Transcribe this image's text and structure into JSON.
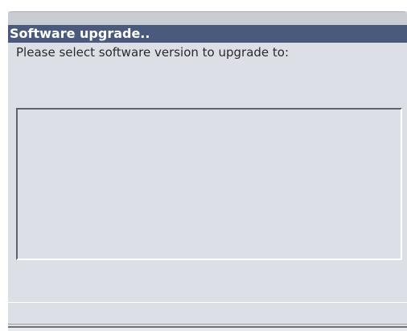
{
  "dialog": {
    "title": "Software upgrade..",
    "prompt": "Please select software version to upgrade to:"
  }
}
